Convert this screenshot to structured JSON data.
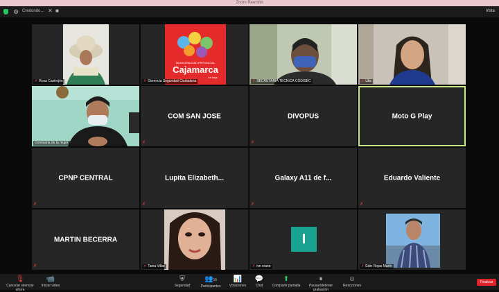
{
  "window": {
    "title": "Zoom Reunión"
  },
  "topbar": {
    "meeting_name": "Credondo…",
    "view_label": "Vista"
  },
  "tiles": {
    "t1": {
      "label": "Rosa Castrejón"
    },
    "t2": {
      "label": "Gerencia Seguridad Ciudadana",
      "logo_top": "MUNICIPALIDAD PROVINCIAL",
      "logo_city": "Cajamarca",
      "logo_sub": "es tuya"
    },
    "t3": {
      "label": "SECRETARIA TECNICA CODISEC"
    },
    "t4": {
      "label": "Ulia"
    },
    "t5": {
      "label": "Comisaria de la mujer"
    },
    "t6": {
      "name": "COM SAN JOSE"
    },
    "t7": {
      "name": "DIVOPUS"
    },
    "t8": {
      "name": "Moto G Play"
    },
    "t9": {
      "name": "CPNP CENTRAL"
    },
    "t10": {
      "name": "Lupita  Elizabeth..."
    },
    "t11": {
      "name": "Galaxy  A11 de f..."
    },
    "t12": {
      "name": "Eduardo Valiente"
    },
    "t13": {
      "name": "MARTIN BECERRA"
    },
    "t14": {
      "label": "Tania Villar"
    },
    "t15": {
      "label": "ivn crane",
      "initial": "I"
    },
    "t16": {
      "label": "Edin Rojas Marín"
    }
  },
  "toolbar": {
    "unmute": "Cancelar silenciar ahora",
    "video": "Iniciar video",
    "security": "Seguridad",
    "participants": "Participantes",
    "participants_count": "16",
    "polls": "Votaciones",
    "chat": "Chat",
    "share": "Compartir pantalla",
    "record": "Pausar/detener grabación",
    "reactions": "Reacciones",
    "leave": "Finalizar"
  },
  "colors": {
    "active_speaker": "#c9e887",
    "muted": "#e03b3b",
    "leave": "#e0232b",
    "share": "#2ecc71"
  }
}
